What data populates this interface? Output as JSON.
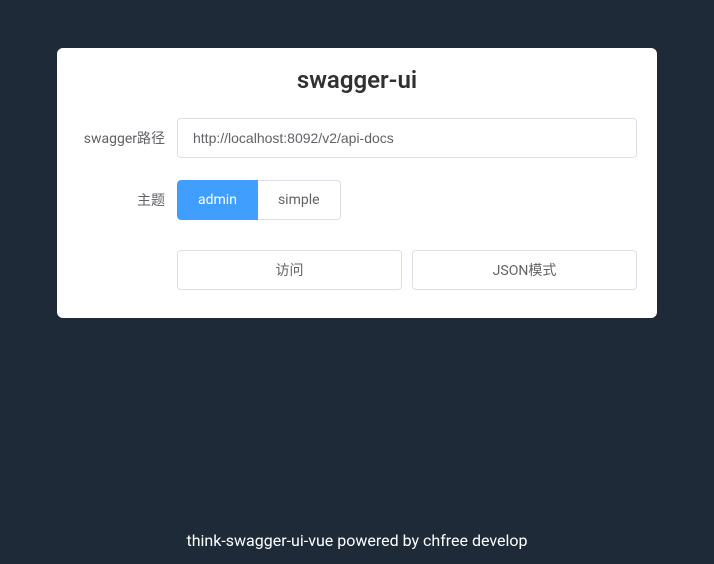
{
  "title": "swagger-ui",
  "form": {
    "path_label": "swagger路径",
    "path_value": "http://localhost:8092/v2/api-docs",
    "theme_label": "主题",
    "theme_options": {
      "admin": "admin",
      "simple": "simple"
    }
  },
  "actions": {
    "visit": "访问",
    "json_mode": "JSON模式"
  },
  "footer": "think-swagger-ui-vue powered by chfree develop"
}
